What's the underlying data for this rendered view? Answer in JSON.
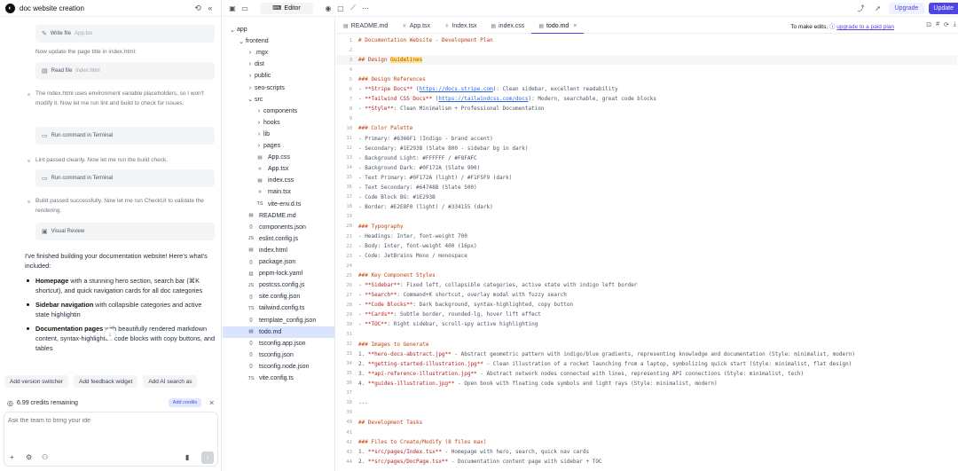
{
  "chat": {
    "title": "doc website creation",
    "tool_cards": [
      {
        "label": "Write file",
        "detail": "App.tsx"
      },
      {
        "label": "Read file",
        "detail": "index.html"
      },
      {
        "label": "Run command in Terminal",
        "detail": ""
      },
      {
        "label": "Run command in Terminal",
        "detail": ""
      },
      {
        "label": "Visual Review",
        "detail": ""
      }
    ],
    "messages": [
      "Now update the page title in index.html:",
      "The index.html uses environment variable placeholders, so I won't modify it. Now let me run lint and build to check for issues.",
      "Lint passed cleanly. Now let me run the build check.",
      "Build passed successfully. Now let me run CheckUI to validate the rendering."
    ],
    "final_intro": "I've finished building your documentation website! Here's what's included:",
    "final_items": [
      {
        "bold": "Homepage",
        "text": " with a stunning hero section, search bar (⌘K shortcut), and quick navigation cards for all doc categories"
      },
      {
        "bold": "Sidebar navigation",
        "text": " with collapsible categories and active state highlightin"
      },
      {
        "bold": "Documentation pages",
        "text": " with beautifully rendered markdown content, syntax-highlighted code blocks with copy buttons, and tables"
      }
    ],
    "suggestions": [
      "Add version switcher",
      "Add feedback widget",
      "Add AI search as"
    ],
    "credits_text": "6.99 credits remaining",
    "add_credits": "Add credits",
    "composer_placeholder": "Ask the team to bring your ide"
  },
  "topbar": {
    "editor_label": "Editor",
    "upgrade_label": "Upgrade",
    "update_label": "Update"
  },
  "tree": {
    "rows": [
      {
        "label": "app",
        "chev": "⌄",
        "icon": "",
        "indent": 0
      },
      {
        "label": "frontend",
        "chev": "⌄",
        "icon": "",
        "indent": 1
      },
      {
        "label": ".mgx",
        "chev": "›",
        "icon": "",
        "indent": 2
      },
      {
        "label": "dist",
        "chev": "›",
        "icon": "",
        "indent": 2
      },
      {
        "label": "public",
        "chev": "›",
        "icon": "",
        "indent": 2
      },
      {
        "label": "seo-scripts",
        "chev": "›",
        "icon": "",
        "indent": 2
      },
      {
        "label": "src",
        "chev": "⌄",
        "icon": "",
        "indent": 2
      },
      {
        "label": "components",
        "chev": "›",
        "icon": "",
        "indent": 3
      },
      {
        "label": "hooks",
        "chev": "›",
        "icon": "",
        "indent": 3
      },
      {
        "label": "lib",
        "chev": "›",
        "icon": "",
        "indent": 3
      },
      {
        "label": "pages",
        "chev": "›",
        "icon": "",
        "indent": 3
      },
      {
        "label": "App.css",
        "chev": "",
        "icon": "▤",
        "indent": 3
      },
      {
        "label": "App.tsx",
        "chev": "",
        "icon": "⚛",
        "indent": 3
      },
      {
        "label": "index.css",
        "chev": "",
        "icon": "▤",
        "indent": 3
      },
      {
        "label": "main.tsx",
        "chev": "",
        "icon": "⚛",
        "indent": 3
      },
      {
        "label": "vite-env.d.ts",
        "chev": "",
        "icon": "TS",
        "indent": 3
      },
      {
        "label": "README.md",
        "chev": "",
        "icon": "▤",
        "indent": 2
      },
      {
        "label": "components.json",
        "chev": "",
        "icon": "{}",
        "indent": 2
      },
      {
        "label": "eslint.config.js",
        "chev": "",
        "icon": "JS",
        "indent": 2
      },
      {
        "label": "index.html",
        "chev": "",
        "icon": "▤",
        "indent": 2
      },
      {
        "label": "package.json",
        "chev": "",
        "icon": "{}",
        "indent": 2
      },
      {
        "label": "pnpm-lock.yaml",
        "chev": "",
        "icon": "▥",
        "indent": 2
      },
      {
        "label": "postcss.config.js",
        "chev": "",
        "icon": "JS",
        "indent": 2
      },
      {
        "label": "site.config.json",
        "chev": "",
        "icon": "{}",
        "indent": 2
      },
      {
        "label": "tailwind.config.ts",
        "chev": "",
        "icon": "TS",
        "indent": 2
      },
      {
        "label": "template_config.json",
        "chev": "",
        "icon": "{}",
        "indent": 2
      },
      {
        "label": "todo.md",
        "chev": "",
        "icon": "▤",
        "indent": 2,
        "selected": true
      },
      {
        "label": "tsconfig.app.json",
        "chev": "",
        "icon": "{}",
        "indent": 2
      },
      {
        "label": "tsconfig.json",
        "chev": "",
        "icon": "{}",
        "indent": 2
      },
      {
        "label": "tsconfig.node.json",
        "chev": "",
        "icon": "{}",
        "indent": 2
      },
      {
        "label": "vite.config.ts",
        "chev": "",
        "icon": "TS",
        "indent": 2
      }
    ]
  },
  "tabs": [
    {
      "label": "README.md",
      "icon": "▤",
      "active": false
    },
    {
      "label": "App.tsx",
      "icon": "⚛",
      "active": false
    },
    {
      "label": "Index.tsx",
      "icon": "⚛",
      "active": false
    },
    {
      "label": "index.css",
      "icon": "▤",
      "active": false
    },
    {
      "label": "todo.md",
      "icon": "▤",
      "active": true
    }
  ],
  "edit_note": {
    "prefix": "To make edits,",
    "link": "upgrade to a paid plan"
  },
  "code_lines": [
    [
      {
        "t": "# Documentation Website - Development Plan",
        "c": "h1"
      }
    ],
    [],
    [
      {
        "t": "## Design ",
        "c": "h1"
      },
      {
        "t": "Guidelines",
        "c": "hl"
      }
    ],
    [],
    [
      {
        "t": "### Design References",
        "c": "h1"
      }
    ],
    [
      {
        "t": "- ",
        "c": "txt"
      },
      {
        "t": "**Stripe Docs**",
        "c": "bold"
      },
      {
        "t": " (",
        "c": "txt"
      },
      {
        "t": "https://docs.stripe.com",
        "c": "link"
      },
      {
        "t": "): Clean sidebar, excellent readability",
        "c": "txt"
      }
    ],
    [
      {
        "t": "- ",
        "c": "txt"
      },
      {
        "t": "**Tailwind CSS Docs**",
        "c": "bold"
      },
      {
        "t": " (",
        "c": "txt"
      },
      {
        "t": "https://tailwindcss.com/docs",
        "c": "link"
      },
      {
        "t": "): Modern, searchable, great code blocks",
        "c": "txt"
      }
    ],
    [
      {
        "t": "- ",
        "c": "txt"
      },
      {
        "t": "**Style**",
        "c": "bold"
      },
      {
        "t": ": Clean Minimalism + Professional Documentation",
        "c": "txt"
      }
    ],
    [],
    [
      {
        "t": "### Color Palette",
        "c": "h1"
      }
    ],
    [
      {
        "t": "- Primary: #6366F1 (Indigo - brand accent)",
        "c": "txt"
      }
    ],
    [
      {
        "t": "- Secondary: #1E293B (Slate 800 - sidebar bg in dark)",
        "c": "txt"
      }
    ],
    [
      {
        "t": "- Background Light: #FFFFFF / #F8FAFC",
        "c": "txt"
      }
    ],
    [
      {
        "t": "- Background Dark: #0F172A (Slate 900)",
        "c": "txt"
      }
    ],
    [
      {
        "t": "- Text Primary: #0F172A (light) / #F1F5F9 (dark)",
        "c": "txt"
      }
    ],
    [
      {
        "t": "- Text Secondary: #64748B (Slate 500)",
        "c": "txt"
      }
    ],
    [
      {
        "t": "- Code Block BG: #1E293B",
        "c": "txt"
      }
    ],
    [
      {
        "t": "- Border: #E2E8F0 (light) / #334155 (dark)",
        "c": "txt"
      }
    ],
    [],
    [
      {
        "t": "### Typography",
        "c": "h1"
      }
    ],
    [
      {
        "t": "- Headings: Inter, font-weight 700",
        "c": "txt"
      }
    ],
    [
      {
        "t": "- Body: Inter, font-weight 400 (16px)",
        "c": "txt"
      }
    ],
    [
      {
        "t": "- Code: JetBrains Mono / monospace",
        "c": "txt"
      }
    ],
    [],
    [
      {
        "t": "### Key Component Styles",
        "c": "h1"
      }
    ],
    [
      {
        "t": "- ",
        "c": "txt"
      },
      {
        "t": "**Sidebar**",
        "c": "bold"
      },
      {
        "t": ": Fixed left, collapsible categories, active state with indigo left border",
        "c": "txt"
      }
    ],
    [
      {
        "t": "- ",
        "c": "txt"
      },
      {
        "t": "**Search**",
        "c": "bold"
      },
      {
        "t": ": Command+K shortcut, overlay modal with fuzzy search",
        "c": "txt"
      }
    ],
    [
      {
        "t": "- ",
        "c": "txt"
      },
      {
        "t": "**Code Blocks**",
        "c": "bold"
      },
      {
        "t": ": Dark background, syntax-highlighted, copy button",
        "c": "txt"
      }
    ],
    [
      {
        "t": "- ",
        "c": "txt"
      },
      {
        "t": "**Cards**",
        "c": "bold"
      },
      {
        "t": ": Subtle border, rounded-lg, hover lift effect",
        "c": "txt"
      }
    ],
    [
      {
        "t": "- ",
        "c": "txt"
      },
      {
        "t": "**TOC**",
        "c": "bold"
      },
      {
        "t": ": Right sidebar, scroll-spy active highlighting",
        "c": "txt"
      }
    ],
    [],
    [
      {
        "t": "### Images to Generate",
        "c": "h1"
      }
    ],
    [
      {
        "t": "1. ",
        "c": "txt"
      },
      {
        "t": "**hero-docs-abstract.jpg**",
        "c": "bold"
      },
      {
        "t": " - Abstract geometric pattern with indigo/blue gradients, representing knowledge and documentation (Style: minimalist, modern)",
        "c": "txt"
      }
    ],
    [
      {
        "t": "2. ",
        "c": "txt"
      },
      {
        "t": "**getting-started-illustration.jpg**",
        "c": "bold"
      },
      {
        "t": " - Clean illustration of a rocket launching from a laptop, symbolizing quick start (Style: minimalist, flat design)",
        "c": "txt"
      }
    ],
    [
      {
        "t": "3. ",
        "c": "txt"
      },
      {
        "t": "**api-reference-illustration.jpg**",
        "c": "bold"
      },
      {
        "t": " - Abstract network nodes connected with lines, representing API connections (Style: minimalist, tech)",
        "c": "txt"
      }
    ],
    [
      {
        "t": "4. ",
        "c": "txt"
      },
      {
        "t": "**guides-illustration.jpg**",
        "c": "bold"
      },
      {
        "t": " - Open book with floating code symbols and light rays (Style: minimalist, modern)",
        "c": "txt"
      }
    ],
    [],
    [
      {
        "t": "---",
        "c": "txt"
      }
    ],
    [],
    [
      {
        "t": "## Development Tasks",
        "c": "h1"
      }
    ],
    [],
    [
      {
        "t": "### Files to Create/Modify (8 files max)",
        "c": "h1"
      }
    ],
    [
      {
        "t": "1. ",
        "c": "txt"
      },
      {
        "t": "**src/pages/Index.tsx**",
        "c": "bold"
      },
      {
        "t": " - Homepage with hero, search, quick nav cards",
        "c": "txt"
      }
    ],
    [
      {
        "t": "2. ",
        "c": "txt"
      },
      {
        "t": "**src/pages/DocPage.tsx**",
        "c": "bold"
      },
      {
        "t": " - Documentation content page with sidebar + TOC",
        "c": "txt"
      }
    ]
  ]
}
